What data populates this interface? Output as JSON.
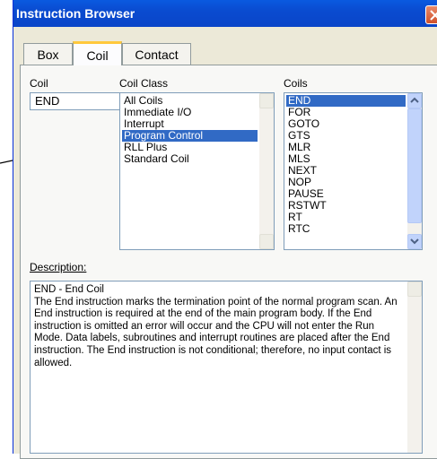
{
  "window": {
    "title": "Instruction Browser",
    "close_icon": "close-icon"
  },
  "tabs": [
    {
      "label": "Box"
    },
    {
      "label": "Coil"
    },
    {
      "label": "Contact"
    }
  ],
  "coil": {
    "label": "Coil",
    "value": "END"
  },
  "coil_class": {
    "label": "Coil Class",
    "items": [
      "All Coils",
      "Immediate I/O",
      "Interrupt",
      "Program Control",
      "RLL Plus",
      "Standard Coil"
    ],
    "selected": "Program Control"
  },
  "coils": {
    "label": "Coils",
    "items": [
      "END",
      "FOR",
      "GOTO",
      "GTS",
      "MLR",
      "MLS",
      "NEXT",
      "NOP",
      "PAUSE",
      "RSTWT",
      "RT",
      "RTC"
    ],
    "selected": "END"
  },
  "description": {
    "label": "Description:",
    "title": "END - End Coil",
    "text": "The End instruction marks the termination point of the normal program scan. An End instruction is required at the end of the main program body. If the End instruction is omitted an error will occur and the CPU will not enter the Run Mode. Data labels, subroutines and interrupt routines are placed after the End instruction. The End instruction is not conditional; therefore, no input contact is allowed."
  },
  "colors": {
    "titlebar": "#0a4bd0",
    "selection": "#316ac5",
    "window_bg": "#ece9d8"
  }
}
